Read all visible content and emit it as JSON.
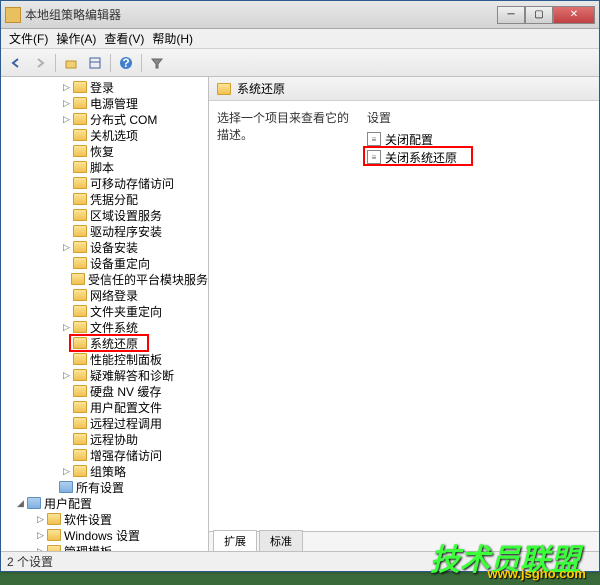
{
  "window": {
    "title": "本地组策略编辑器"
  },
  "menubar": {
    "items": [
      "文件(F)",
      "操作(A)",
      "查看(V)",
      "帮助(H)"
    ]
  },
  "tree": {
    "items": [
      {
        "label": "登录",
        "indent": 60,
        "exp": "▷"
      },
      {
        "label": "电源管理",
        "indent": 60,
        "exp": "▷"
      },
      {
        "label": "分布式 COM",
        "indent": 60,
        "exp": "▷"
      },
      {
        "label": "关机选项",
        "indent": 60,
        "exp": ""
      },
      {
        "label": "恢复",
        "indent": 60,
        "exp": ""
      },
      {
        "label": "脚本",
        "indent": 60,
        "exp": ""
      },
      {
        "label": "可移动存储访问",
        "indent": 60,
        "exp": ""
      },
      {
        "label": "凭据分配",
        "indent": 60,
        "exp": ""
      },
      {
        "label": "区域设置服务",
        "indent": 60,
        "exp": ""
      },
      {
        "label": "驱动程序安装",
        "indent": 60,
        "exp": ""
      },
      {
        "label": "设备安装",
        "indent": 60,
        "exp": "▷"
      },
      {
        "label": "设备重定向",
        "indent": 60,
        "exp": ""
      },
      {
        "label": "受信任的平台模块服务",
        "indent": 60,
        "exp": ""
      },
      {
        "label": "网络登录",
        "indent": 60,
        "exp": ""
      },
      {
        "label": "文件夹重定向",
        "indent": 60,
        "exp": ""
      },
      {
        "label": "文件系统",
        "indent": 60,
        "exp": "▷"
      },
      {
        "label": "系统还原",
        "indent": 60,
        "exp": "",
        "highlight": true
      },
      {
        "label": "性能控制面板",
        "indent": 60,
        "exp": ""
      },
      {
        "label": "疑难解答和诊断",
        "indent": 60,
        "exp": "▷"
      },
      {
        "label": "硬盘 NV 缓存",
        "indent": 60,
        "exp": ""
      },
      {
        "label": "用户配置文件",
        "indent": 60,
        "exp": ""
      },
      {
        "label": "远程过程调用",
        "indent": 60,
        "exp": ""
      },
      {
        "label": "远程协助",
        "indent": 60,
        "exp": ""
      },
      {
        "label": "增强存储访问",
        "indent": 60,
        "exp": ""
      },
      {
        "label": "组策略",
        "indent": 60,
        "exp": "▷"
      },
      {
        "label": "所有设置",
        "indent": 46,
        "exp": "",
        "special": true
      },
      {
        "label": "用户配置",
        "indent": 14,
        "exp": "◢",
        "special": true
      },
      {
        "label": "软件设置",
        "indent": 34,
        "exp": "▷"
      },
      {
        "label": "Windows 设置",
        "indent": 34,
        "exp": "▷"
      },
      {
        "label": "管理模板",
        "indent": 34,
        "exp": "▷"
      }
    ]
  },
  "detail": {
    "header_title": "系统还原",
    "prompt": "选择一个项目来查看它的描述。",
    "column_header": "设置",
    "settings": [
      {
        "label": "关闭配置"
      },
      {
        "label": "关闭系统还原",
        "highlight": true
      }
    ]
  },
  "tabs": {
    "items": [
      "扩展",
      "标准"
    ]
  },
  "statusbar": {
    "text": "2 个设置"
  },
  "watermark": {
    "text1": "技术员联盟",
    "text2": "www.jsgho.com"
  }
}
